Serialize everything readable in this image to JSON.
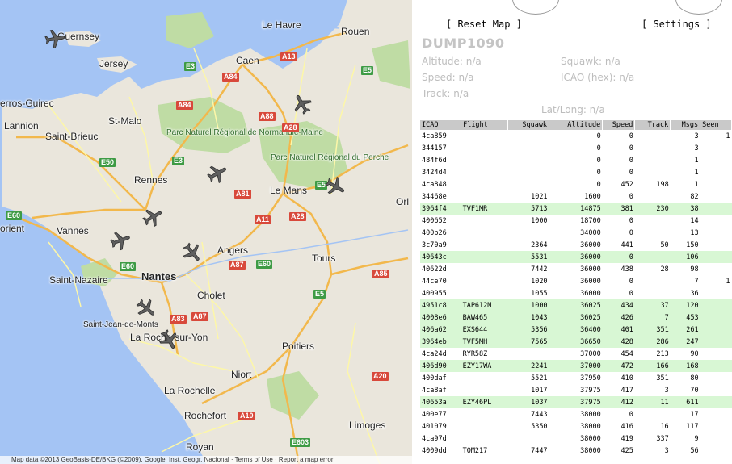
{
  "map": {
    "cities": [
      {
        "id": "guernsey",
        "name": "Guernsey",
        "big": true
      },
      {
        "id": "jersey",
        "name": "Jersey",
        "big": true
      },
      {
        "id": "le-havre",
        "name": "Le Havre"
      },
      {
        "id": "rouen",
        "name": "Rouen"
      },
      {
        "id": "caen",
        "name": "Caen"
      },
      {
        "id": "perros",
        "name": "erros-Guirec"
      },
      {
        "id": "lannion",
        "name": "Lannion"
      },
      {
        "id": "st-malo",
        "name": "St-Malo"
      },
      {
        "id": "saint-brieuc",
        "name": "Saint-Brieuc"
      },
      {
        "id": "rennes",
        "name": "Rennes"
      },
      {
        "id": "le-mans",
        "name": "Le Mans"
      },
      {
        "id": "orl",
        "name": "Orl"
      },
      {
        "id": "lorient",
        "name": "orient"
      },
      {
        "id": "vannes",
        "name": "Vannes"
      },
      {
        "id": "angers",
        "name": "Angers"
      },
      {
        "id": "tours",
        "name": "Tours"
      },
      {
        "id": "saint-nazaire",
        "name": "Saint-Nazaire"
      },
      {
        "id": "nantes",
        "name": "Nantes",
        "big": true
      },
      {
        "id": "cholet",
        "name": "Cholet"
      },
      {
        "id": "saint-jean",
        "name": "Saint-Jean-de-Monts"
      },
      {
        "id": "la-roche",
        "name": "La Roche-sur-Yon"
      },
      {
        "id": "poitiers",
        "name": "Poitiers"
      },
      {
        "id": "niort",
        "name": "Niort"
      },
      {
        "id": "la-rochelle",
        "name": "La Rochelle"
      },
      {
        "id": "rochefort",
        "name": "Rochefort"
      },
      {
        "id": "limoges",
        "name": "Limoges"
      },
      {
        "id": "royan",
        "name": "Royan"
      }
    ],
    "parks": [
      {
        "id": "normandie-maine",
        "name": "Parc Naturel Régional de Normandie-Maine"
      },
      {
        "id": "perche",
        "name": "Parc Naturel Régional du Perche"
      }
    ],
    "roads": [
      {
        "id": "a13",
        "label": "A13",
        "color": "red"
      },
      {
        "id": "e5-top",
        "label": "E5",
        "color": "green"
      },
      {
        "id": "e3-top",
        "label": "E3",
        "color": "green"
      },
      {
        "id": "a84-top",
        "label": "A84",
        "color": "red"
      },
      {
        "id": "a84-mid",
        "label": "A84",
        "color": "red"
      },
      {
        "id": "a88",
        "label": "A88",
        "color": "red"
      },
      {
        "id": "a28-top",
        "label": "A28",
        "color": "red"
      },
      {
        "id": "e50",
        "label": "E50",
        "color": "green"
      },
      {
        "id": "e3-mid",
        "label": "E3",
        "color": "green"
      },
      {
        "id": "e5-mid",
        "label": "E5",
        "color": "green"
      },
      {
        "id": "a81",
        "label": "A81",
        "color": "red"
      },
      {
        "id": "e60-left",
        "label": "E60",
        "color": "green"
      },
      {
        "id": "a11",
        "label": "A11",
        "color": "red"
      },
      {
        "id": "a28-mid",
        "label": "A28",
        "color": "red"
      },
      {
        "id": "e60-mid",
        "label": "E60",
        "color": "green"
      },
      {
        "id": "a87-top",
        "label": "A87",
        "color": "red"
      },
      {
        "id": "e60-right",
        "label": "E60",
        "color": "green"
      },
      {
        "id": "a85",
        "label": "A85",
        "color": "red"
      },
      {
        "id": "e5-low",
        "label": "E5",
        "color": "green"
      },
      {
        "id": "a87-low",
        "label": "A87",
        "color": "red"
      },
      {
        "id": "a83",
        "label": "A83",
        "color": "red"
      },
      {
        "id": "a20",
        "label": "A20",
        "color": "red"
      },
      {
        "id": "a10",
        "label": "A10",
        "color": "red"
      },
      {
        "id": "e603",
        "label": "E603",
        "color": "green"
      }
    ],
    "planes": [
      {
        "id": "p1",
        "heading": 80
      },
      {
        "id": "p2",
        "heading": -30
      },
      {
        "id": "p3",
        "heading": 60
      },
      {
        "id": "p4",
        "heading": 120
      },
      {
        "id": "p5",
        "heading": 60
      },
      {
        "id": "p6",
        "heading": 70
      },
      {
        "id": "p7",
        "heading": 140
      },
      {
        "id": "p8",
        "heading": 130
      },
      {
        "id": "p9",
        "heading": 150
      }
    ],
    "attribution": "Map data ©2013 GeoBasis-DE/BKG (©2009), Google, Inst. Geogr. Nacional · Terms of Use · Report a map error",
    "colors": {
      "land": "#eae6dc",
      "sea": "#a4c4f4",
      "park": "#bfdca4",
      "motorway": "#f2b84c",
      "road": "#fdf7a8"
    }
  },
  "panel": {
    "reset_label": "[ Reset Map ]",
    "settings_label": "[ Settings ]",
    "title": "DUMP1090",
    "fields": {
      "altitude": "Altitude: n/a",
      "squawk": "Squawk: n/a",
      "speed": "Speed: n/a",
      "icao": "ICAO (hex): n/a",
      "track": "Track: n/a",
      "latlong": "Lat/Long: n/a"
    },
    "columns": [
      "ICAO",
      "Flight",
      "Squawk",
      "Altitude",
      "Speed",
      "Track",
      "Msgs",
      "Seen"
    ],
    "rows": [
      {
        "icao": "4ca859",
        "flight": "",
        "squawk": "",
        "altitude": "0",
        "speed": "0",
        "track": "",
        "msgs": "3",
        "seen": "1",
        "hl": false
      },
      {
        "icao": "344157",
        "flight": "",
        "squawk": "",
        "altitude": "0",
        "speed": "0",
        "track": "",
        "msgs": "3",
        "seen": "",
        "hl": false
      },
      {
        "icao": "484f6d",
        "flight": "",
        "squawk": "",
        "altitude": "0",
        "speed": "0",
        "track": "",
        "msgs": "1",
        "seen": "",
        "hl": false
      },
      {
        "icao": "3424d4",
        "flight": "",
        "squawk": "",
        "altitude": "0",
        "speed": "0",
        "track": "",
        "msgs": "1",
        "seen": "",
        "hl": false
      },
      {
        "icao": "4ca848",
        "flight": "",
        "squawk": "",
        "altitude": "0",
        "speed": "452",
        "track": "198",
        "msgs": "1",
        "seen": "",
        "hl": false
      },
      {
        "icao": "34468e",
        "flight": "",
        "squawk": "1021",
        "altitude": "1600",
        "speed": "0",
        "track": "",
        "msgs": "82",
        "seen": "",
        "hl": false
      },
      {
        "icao": "3964f4",
        "flight": "TVF1MR",
        "squawk": "5713",
        "altitude": "14875",
        "speed": "381",
        "track": "230",
        "msgs": "38",
        "seen": "",
        "hl": true
      },
      {
        "icao": "400652",
        "flight": "",
        "squawk": "1000",
        "altitude": "18700",
        "speed": "0",
        "track": "",
        "msgs": "14",
        "seen": "",
        "hl": false
      },
      {
        "icao": "400b26",
        "flight": "",
        "squawk": "",
        "altitude": "34000",
        "speed": "0",
        "track": "",
        "msgs": "13",
        "seen": "",
        "hl": false
      },
      {
        "icao": "3c70a9",
        "flight": "",
        "squawk": "2364",
        "altitude": "36000",
        "speed": "441",
        "track": "50",
        "msgs": "150",
        "seen": "",
        "hl": false
      },
      {
        "icao": "40643c",
        "flight": "",
        "squawk": "5531",
        "altitude": "36000",
        "speed": "0",
        "track": "",
        "msgs": "106",
        "seen": "",
        "hl": true
      },
      {
        "icao": "40622d",
        "flight": "",
        "squawk": "7442",
        "altitude": "36000",
        "speed": "438",
        "track": "28",
        "msgs": "98",
        "seen": "",
        "hl": false
      },
      {
        "icao": "44ce70",
        "flight": "",
        "squawk": "1020",
        "altitude": "36000",
        "speed": "0",
        "track": "",
        "msgs": "7",
        "seen": "1",
        "hl": false
      },
      {
        "icao": "400955",
        "flight": "",
        "squawk": "1055",
        "altitude": "36000",
        "speed": "0",
        "track": "",
        "msgs": "36",
        "seen": "",
        "hl": false
      },
      {
        "icao": "4951c8",
        "flight": "TAP612M",
        "squawk": "1000",
        "altitude": "36025",
        "speed": "434",
        "track": "37",
        "msgs": "120",
        "seen": "",
        "hl": true
      },
      {
        "icao": "4008e6",
        "flight": "BAW465",
        "squawk": "1043",
        "altitude": "36025",
        "speed": "426",
        "track": "7",
        "msgs": "453",
        "seen": "",
        "hl": true
      },
      {
        "icao": "406a62",
        "flight": "EXS644",
        "squawk": "5356",
        "altitude": "36400",
        "speed": "401",
        "track": "351",
        "msgs": "261",
        "seen": "",
        "hl": true
      },
      {
        "icao": "3964eb",
        "flight": "TVF5MH",
        "squawk": "7565",
        "altitude": "36650",
        "speed": "428",
        "track": "286",
        "msgs": "247",
        "seen": "",
        "hl": true
      },
      {
        "icao": "4ca24d",
        "flight": "RYR58Z",
        "squawk": "",
        "altitude": "37000",
        "speed": "454",
        "track": "213",
        "msgs": "90",
        "seen": "",
        "hl": false
      },
      {
        "icao": "406d90",
        "flight": "EZY17WA",
        "squawk": "2241",
        "altitude": "37000",
        "speed": "472",
        "track": "166",
        "msgs": "168",
        "seen": "",
        "hl": true
      },
      {
        "icao": "400daf",
        "flight": "",
        "squawk": "5521",
        "altitude": "37950",
        "speed": "410",
        "track": "351",
        "msgs": "80",
        "seen": "",
        "hl": false
      },
      {
        "icao": "4ca8af",
        "flight": "",
        "squawk": "1017",
        "altitude": "37975",
        "speed": "417",
        "track": "3",
        "msgs": "70",
        "seen": "",
        "hl": false
      },
      {
        "icao": "40653a",
        "flight": "EZY46PL",
        "squawk": "1037",
        "altitude": "37975",
        "speed": "412",
        "track": "11",
        "msgs": "611",
        "seen": "",
        "hl": true
      },
      {
        "icao": "400e77",
        "flight": "",
        "squawk": "7443",
        "altitude": "38000",
        "speed": "0",
        "track": "",
        "msgs": "17",
        "seen": "",
        "hl": false
      },
      {
        "icao": "401079",
        "flight": "",
        "squawk": "5350",
        "altitude": "38000",
        "speed": "416",
        "track": "16",
        "msgs": "117",
        "seen": "",
        "hl": false
      },
      {
        "icao": "4ca97d",
        "flight": "",
        "squawk": "",
        "altitude": "38000",
        "speed": "419",
        "track": "337",
        "msgs": "9",
        "seen": "",
        "hl": false
      },
      {
        "icao": "4009dd",
        "flight": "TOM217",
        "squawk": "7447",
        "altitude": "38000",
        "speed": "425",
        "track": "3",
        "msgs": "56",
        "seen": "",
        "hl": false
      }
    ],
    "colors": {
      "selected_row": "#d8f7d4",
      "header": "#c9c9c9",
      "muted_text": "#bdbdbd"
    }
  }
}
